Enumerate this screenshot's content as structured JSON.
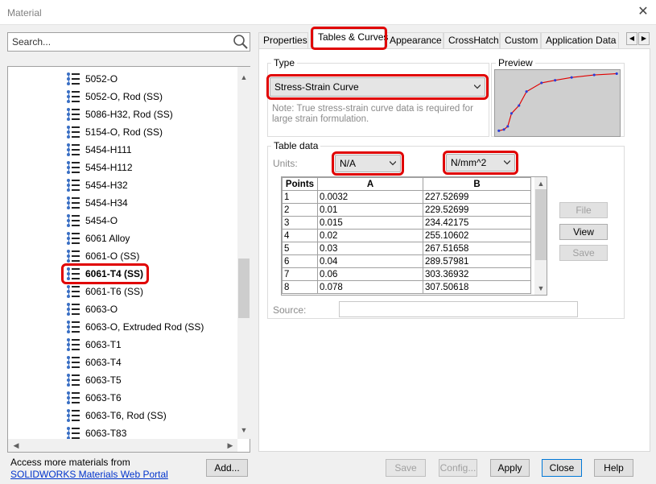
{
  "window": {
    "title": "Material"
  },
  "search": {
    "placeholder": "Search..."
  },
  "tree": {
    "items": [
      {
        "label": "5052-O"
      },
      {
        "label": "5052-O, Rod (SS)"
      },
      {
        "label": "5086-H32, Rod (SS)"
      },
      {
        "label": "5154-O, Rod (SS)"
      },
      {
        "label": "5454-H111"
      },
      {
        "label": "5454-H112"
      },
      {
        "label": "5454-H32"
      },
      {
        "label": "5454-H34"
      },
      {
        "label": "5454-O"
      },
      {
        "label": "6061 Alloy"
      },
      {
        "label": "6061-O (SS)"
      },
      {
        "label": "6061-T4 (SS)"
      },
      {
        "label": "6061-T6 (SS)"
      },
      {
        "label": "6063-O"
      },
      {
        "label": "6063-O, Extruded Rod (SS)"
      },
      {
        "label": "6063-T1"
      },
      {
        "label": "6063-T4"
      },
      {
        "label": "6063-T5"
      },
      {
        "label": "6063-T6"
      },
      {
        "label": "6063-T6, Rod (SS)"
      },
      {
        "label": "6063-T83"
      }
    ],
    "selected_index": 11
  },
  "footer": {
    "access_text": "Access more materials from",
    "portal_link": "SOLIDWORKS Materials Web Portal",
    "add_label": "Add...",
    "save_label": "Save",
    "config_label": "Config...",
    "apply_label": "Apply",
    "close_label": "Close",
    "help_label": "Help"
  },
  "tabs": [
    {
      "label": "Properties"
    },
    {
      "label": "Tables & Curves"
    },
    {
      "label": "Appearance"
    },
    {
      "label": "CrossHatch"
    },
    {
      "label": "Custom"
    },
    {
      "label": "Application Data"
    }
  ],
  "type_group": {
    "label": "Type",
    "selected": "Stress-Strain Curve",
    "note": "Note: True stress-strain curve data is required for large strain formulation."
  },
  "preview": {
    "label": "Preview",
    "curve": [
      [
        0.0032,
        227.52699
      ],
      [
        0.01,
        229.52699
      ],
      [
        0.015,
        234.42175
      ],
      [
        0.02,
        255.10602
      ],
      [
        0.03,
        267.51658
      ],
      [
        0.04,
        289.57981
      ],
      [
        0.06,
        303.36932
      ],
      [
        0.078,
        307.50618
      ],
      [
        0.1,
        312.0
      ],
      [
        0.13,
        316.0
      ],
      [
        0.16,
        318.0
      ]
    ]
  },
  "table_data": {
    "label": "Table data",
    "units_label": "Units:",
    "unit_a": "N/A",
    "unit_b": "N/mm^2",
    "headers": {
      "points": "Points",
      "a": "A",
      "b": "B"
    },
    "rows": [
      {
        "p": "1",
        "a": "0.0032",
        "b": "227.52699"
      },
      {
        "p": "2",
        "a": "0.01",
        "b": "229.52699"
      },
      {
        "p": "3",
        "a": "0.015",
        "b": "234.42175"
      },
      {
        "p": "4",
        "a": "0.02",
        "b": "255.10602"
      },
      {
        "p": "5",
        "a": "0.03",
        "b": "267.51658"
      },
      {
        "p": "6",
        "a": "0.04",
        "b": "289.57981"
      },
      {
        "p": "7",
        "a": "0.06",
        "b": "303.36932"
      },
      {
        "p": "8",
        "a": "0.078",
        "b": "307.50618"
      }
    ],
    "file_label": "File",
    "view_label": "View",
    "save_label": "Save",
    "source_label": "Source:"
  },
  "colors": {
    "highlight": "#e00000",
    "link": "#0033cc",
    "curve": "#e00000",
    "curve_points": "#2a3cd8"
  }
}
